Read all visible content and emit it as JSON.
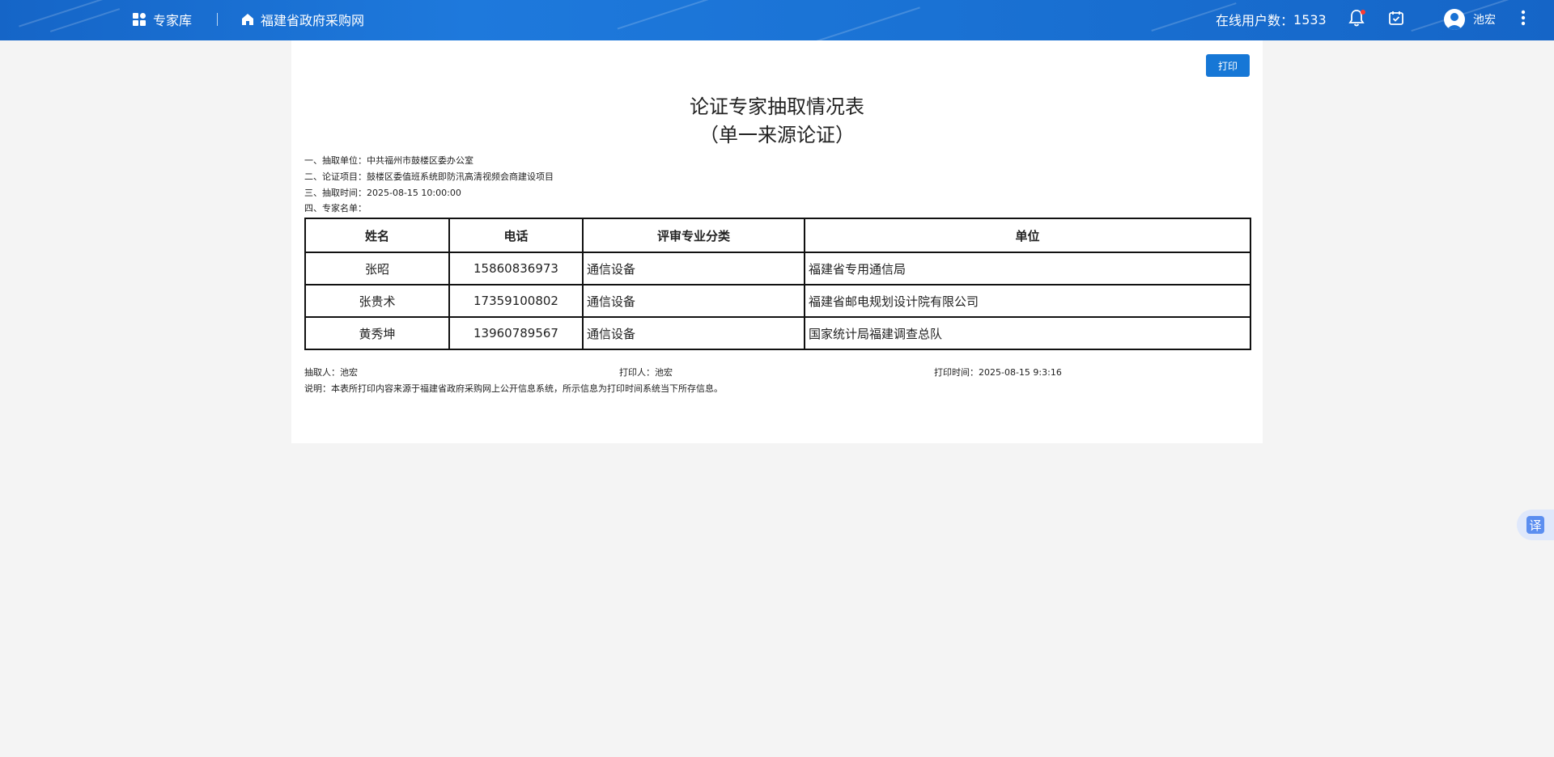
{
  "topbar": {
    "nav": [
      {
        "label": "专家库",
        "icon": "grid-icon"
      },
      {
        "label": "福建省政府采购网",
        "icon": "home-icon"
      }
    ],
    "online_label": "在线用户数：",
    "online_count": "1533",
    "user_name": "池宏",
    "colors": {
      "bar": "#1a72d4",
      "badge": "#ff3b30"
    }
  },
  "toolbar": {
    "print_label": "打印"
  },
  "document": {
    "title": "论证专家抽取情况表",
    "subtitle": "（单一来源论证）",
    "info": {
      "unit": "一、抽取单位：中共福州市鼓楼区委办公室",
      "project": "二、论证项目：鼓楼区委值班系统即防汛高清视频会商建设项目",
      "time": "三、抽取时间：2025-08-15 10:00:00",
      "list": "四、专家名单："
    },
    "table": {
      "headers": [
        "姓名",
        "电话",
        "评审专业分类",
        "单位"
      ],
      "rows": [
        [
          "张昭",
          "15860836973",
          "通信设备",
          "福建省专用通信局"
        ],
        [
          "张贵术",
          "17359100802",
          "通信设备",
          "福建省邮电规划设计院有限公司"
        ],
        [
          "黄秀坤",
          "13960789567",
          "通信设备",
          "国家统计局福建调查总队"
        ]
      ]
    },
    "footer": {
      "extractor": "抽取人：池宏",
      "printer": "打印人：池宏",
      "print_time": "打印时间：2025-08-15 9:3:16",
      "note": "说明：本表所打印内容来源于福建省政府采购网上公开信息系统，所示信息为打印时间系统当下所存信息。"
    }
  },
  "translate": {
    "label": "译"
  }
}
